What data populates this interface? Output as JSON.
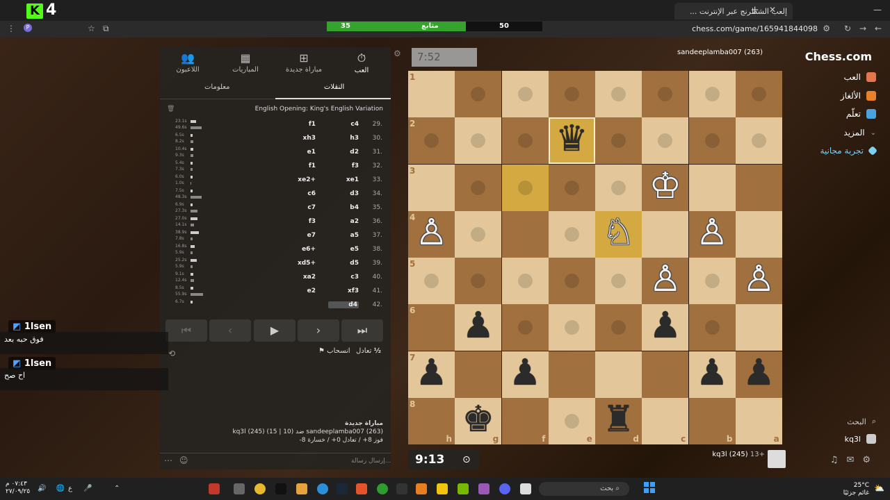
{
  "browser": {
    "tab_title": "إلعب الشطرنج عبر الإنترنت ...",
    "url": "chess.com/game/165941844098",
    "eval_left": "35",
    "eval_mid": "متابع",
    "eval_right": "50",
    "overlay_left_num": "4"
  },
  "sidebar": {
    "logo": "Chess.com",
    "items": [
      {
        "label": "العب",
        "color": "#e4764e"
      },
      {
        "label": "الألغاز",
        "color": "#e8812b"
      },
      {
        "label": "تعلّم",
        "color": "#4aa3df"
      },
      {
        "label": "المزيد",
        "color": "#888888"
      },
      {
        "label": "تجربة مجانية",
        "color": "#7fd0f0"
      }
    ],
    "search": "البحث",
    "user": "kq3l"
  },
  "panel": {
    "tabs": [
      "العب",
      "مباراة جديدة",
      "المباريات",
      "اللاعبون"
    ],
    "subtabs": [
      "النقلات",
      "معلومات"
    ],
    "opening": "English Opening: King's English Variation",
    "moves": [
      {
        "n": "29.",
        "w": "c4",
        "b": "f1",
        "tw": "23.1s",
        "tb": "49.6s",
        "ww": 8,
        "bw": 16
      },
      {
        "n": "30.",
        "w": "h3",
        "b": "xh3",
        "tw": "6.5s",
        "tb": "8.2s",
        "ww": 3,
        "bw": 4
      },
      {
        "n": "31.",
        "w": "d2",
        "b": "e1",
        "tw": "10.4s",
        "tb": "9.3s",
        "ww": 4,
        "bw": 4
      },
      {
        "n": "32.",
        "w": "f3",
        "b": "f1",
        "tw": "5.4s",
        "tb": "7.3s",
        "ww": 3,
        "bw": 3
      },
      {
        "n": "33.",
        "w": "xe1",
        "b": "xe2+",
        "tw": "6.0s",
        "tb": "1.0s",
        "ww": 3,
        "bw": 1
      },
      {
        "n": "34.",
        "w": "d3",
        "b": "c6",
        "tw": "7.5s",
        "tb": "48.3s",
        "ww": 3,
        "bw": 16
      },
      {
        "n": "35.",
        "w": "b4",
        "b": "c7",
        "tw": "6.9s",
        "tb": "27.3s",
        "ww": 3,
        "bw": 10
      },
      {
        "n": "36.",
        "w": "a2",
        "b": "f3",
        "tw": "27.0s",
        "tb": "14.1s",
        "ww": 10,
        "bw": 5
      },
      {
        "n": "37.",
        "w": "a5",
        "b": "e7",
        "tw": "38.9s",
        "tb": "7.8s",
        "ww": 12,
        "bw": 3
      },
      {
        "n": "38.",
        "w": "e5",
        "b": "e6+",
        "tw": "16.8s",
        "tb": "5.9s",
        "ww": 6,
        "bw": 3
      },
      {
        "n": "39.",
        "w": "d5",
        "b": "xd5+",
        "tw": "25.2s",
        "tb": "5.9s",
        "ww": 9,
        "bw": 3
      },
      {
        "n": "40.",
        "w": "c3",
        "b": "xa2",
        "tw": "9.1s",
        "tb": "12.4s",
        "ww": 4,
        "bw": 5
      },
      {
        "n": "41.",
        "w": "xf3",
        "b": "e2",
        "tw": "8.5s",
        "tb": "55.9s",
        "ww": 4,
        "bw": 18
      },
      {
        "n": "42.",
        "w": "d4",
        "b": "",
        "tw": "6.7s",
        "tb": "",
        "ww": 3,
        "bw": 0
      }
    ],
    "draw": "تعادل",
    "half": "½",
    "resign": "انسحاب",
    "new_game": "مباراة جديدة",
    "vs_line": "sandeeplamba007 (263) ضد (10 | 15) (245) kq3l",
    "score_line": "فوز 8+ / تعادل 0+ / خسارة 8-",
    "msg_placeholder": "إرسال رسالة..."
  },
  "board": {
    "clock_top": "7:52",
    "clock_bottom": "9:13",
    "opponent": "sandeeplamba007 (263)",
    "me": "kq3l (245)",
    "me_extra": "13+",
    "files": [
      "h",
      "g",
      "f",
      "e",
      "d",
      "c",
      "b",
      "a"
    ],
    "ranks": [
      "1",
      "2",
      "3",
      "4",
      "5",
      "6",
      "7",
      "8"
    ]
  },
  "chat": [
    {
      "user": "1lsen",
      "msg": "فوق حبه بعد"
    },
    {
      "user": "1lsen",
      "msg": "اح صح"
    }
  ],
  "taskbar": {
    "search": "بحث",
    "time": "٠٧:٤٣ م",
    "date": "٢٧/٠٩/٢٥",
    "temp": "25°C",
    "weather": "غائم جزئيًا",
    "lang": "ع"
  }
}
